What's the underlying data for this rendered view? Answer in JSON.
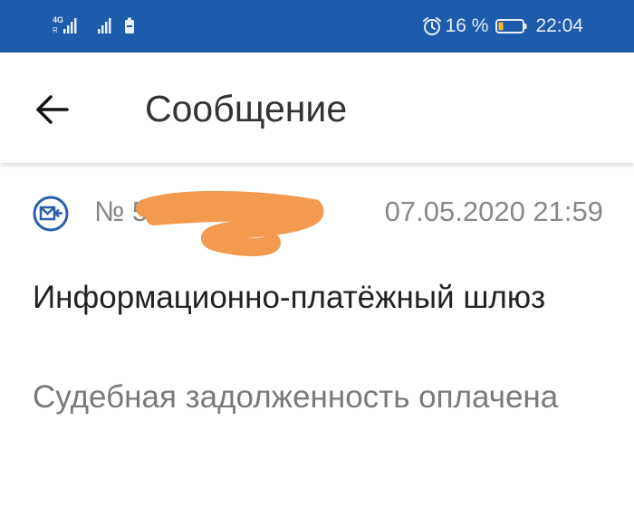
{
  "status_bar": {
    "network_type": "4G",
    "network_sub": "R",
    "battery_percent": "16 %",
    "time": "22:04",
    "icons": [
      "signal-icon",
      "signal-icon",
      "battery-saver-icon",
      "alarm-icon",
      "battery-icon"
    ]
  },
  "header": {
    "title": "Сообщение",
    "back_icon": "arrow-back-icon"
  },
  "message": {
    "icon": "incoming-message-icon",
    "number_prefix": "№ 5",
    "date": "07.05.2020 21:59",
    "sender": "Информационно-платёжный шлюз",
    "body": "Судебная задолженность оплачена"
  },
  "colors": {
    "status_bar": "#1c5cab",
    "icon_blue": "#2a5fae",
    "redaction": "#f29a50",
    "battery_level": "#f3b52b"
  }
}
